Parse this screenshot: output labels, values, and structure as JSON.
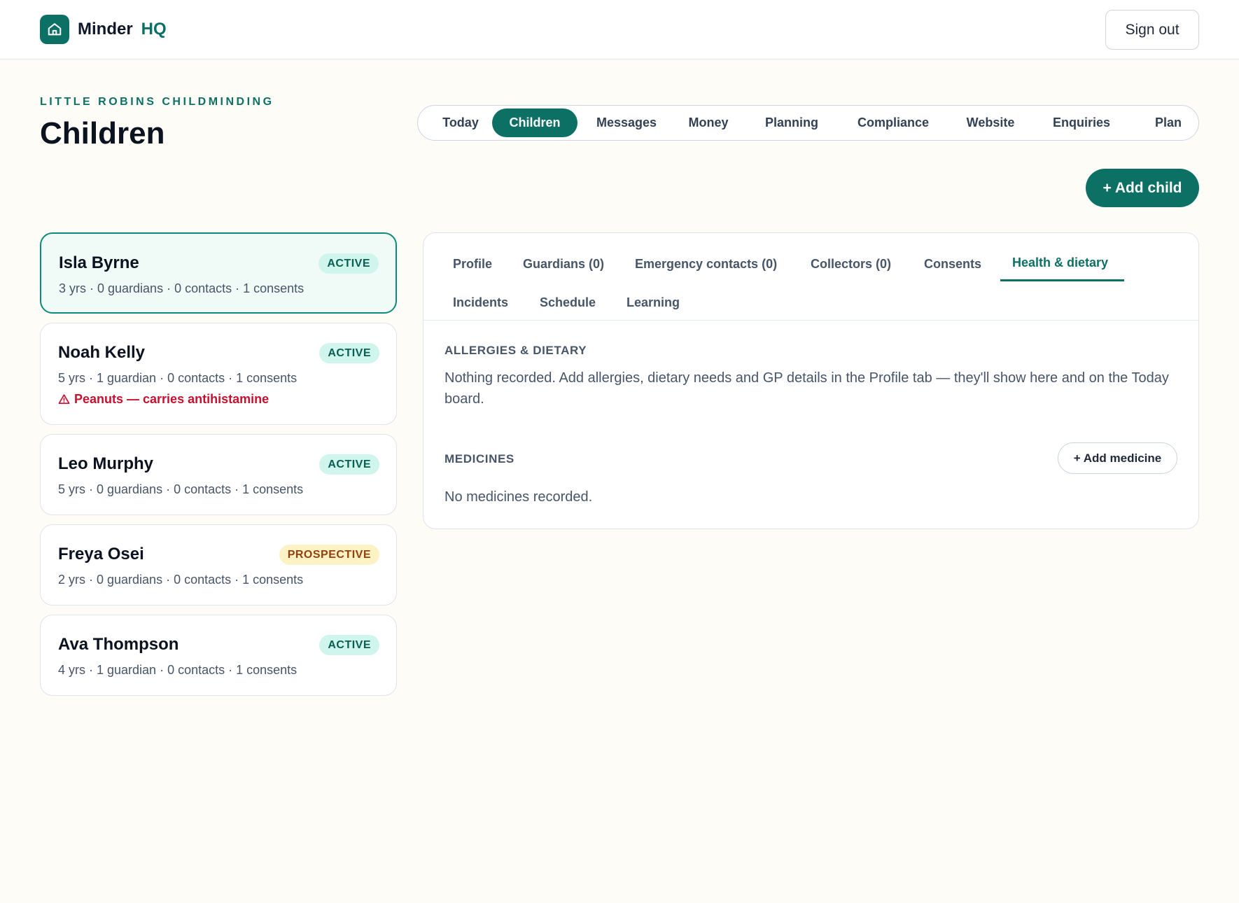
{
  "app": {
    "name": "Minder",
    "suffix": "HQ",
    "logo_icon": "home-icon"
  },
  "header": {
    "signout_label": "Sign out"
  },
  "page": {
    "eyebrow": "LITTLE ROBINS CHILDMINDING",
    "title": "Children"
  },
  "nav": {
    "items": [
      "Today",
      "Children",
      "Messages",
      "Money",
      "Planning",
      "Compliance",
      "Website",
      "Enquiries",
      "Plan"
    ],
    "active": "Children"
  },
  "actions": {
    "add_child_label": "+ Add child"
  },
  "children": [
    {
      "name": "Isla Byrne",
      "status": "ACTIVE",
      "meta": "3 yrs · 0 guardians · 0 contacts · 1 consents",
      "alert": "",
      "selected": true
    },
    {
      "name": "Noah Kelly",
      "status": "ACTIVE",
      "meta": "5 yrs · 1 guardian · 0 contacts · 1 consents",
      "alert": "Peanuts — carries antihistamine",
      "selected": false
    },
    {
      "name": "Leo Murphy",
      "status": "ACTIVE",
      "meta": "5 yrs · 0 guardians · 0 contacts · 1 consents",
      "alert": "",
      "selected": false
    },
    {
      "name": "Freya Osei",
      "status": "PROSPECTIVE",
      "meta": "2 yrs · 0 guardians · 0 contacts · 1 consents",
      "alert": "",
      "selected": false
    },
    {
      "name": "Ava Thompson",
      "status": "ACTIVE",
      "meta": "4 yrs · 1 guardian · 0 contacts · 1 consents",
      "alert": "",
      "selected": false
    }
  ],
  "detail": {
    "tabs": [
      "Profile",
      "Guardians (0)",
      "Emergency contacts (0)",
      "Collectors (0)",
      "Consents",
      "Health & dietary",
      "Incidents",
      "Schedule",
      "Learning"
    ],
    "active_tab": "Health & dietary",
    "allergies": {
      "label": "ALLERGIES & DIETARY",
      "text": "Nothing recorded. Add allergies, dietary needs and GP details in the Profile tab — they'll show here and on the Today board."
    },
    "medicines": {
      "label": "MEDICINES",
      "add_label": "+ Add medicine",
      "empty_text": "No medicines recorded."
    }
  },
  "colors": {
    "accent": "#0d7064",
    "alert": "#c8102e",
    "active_badge_bg": "#cff5ec",
    "prospective_badge_bg": "#fdf2c4"
  }
}
